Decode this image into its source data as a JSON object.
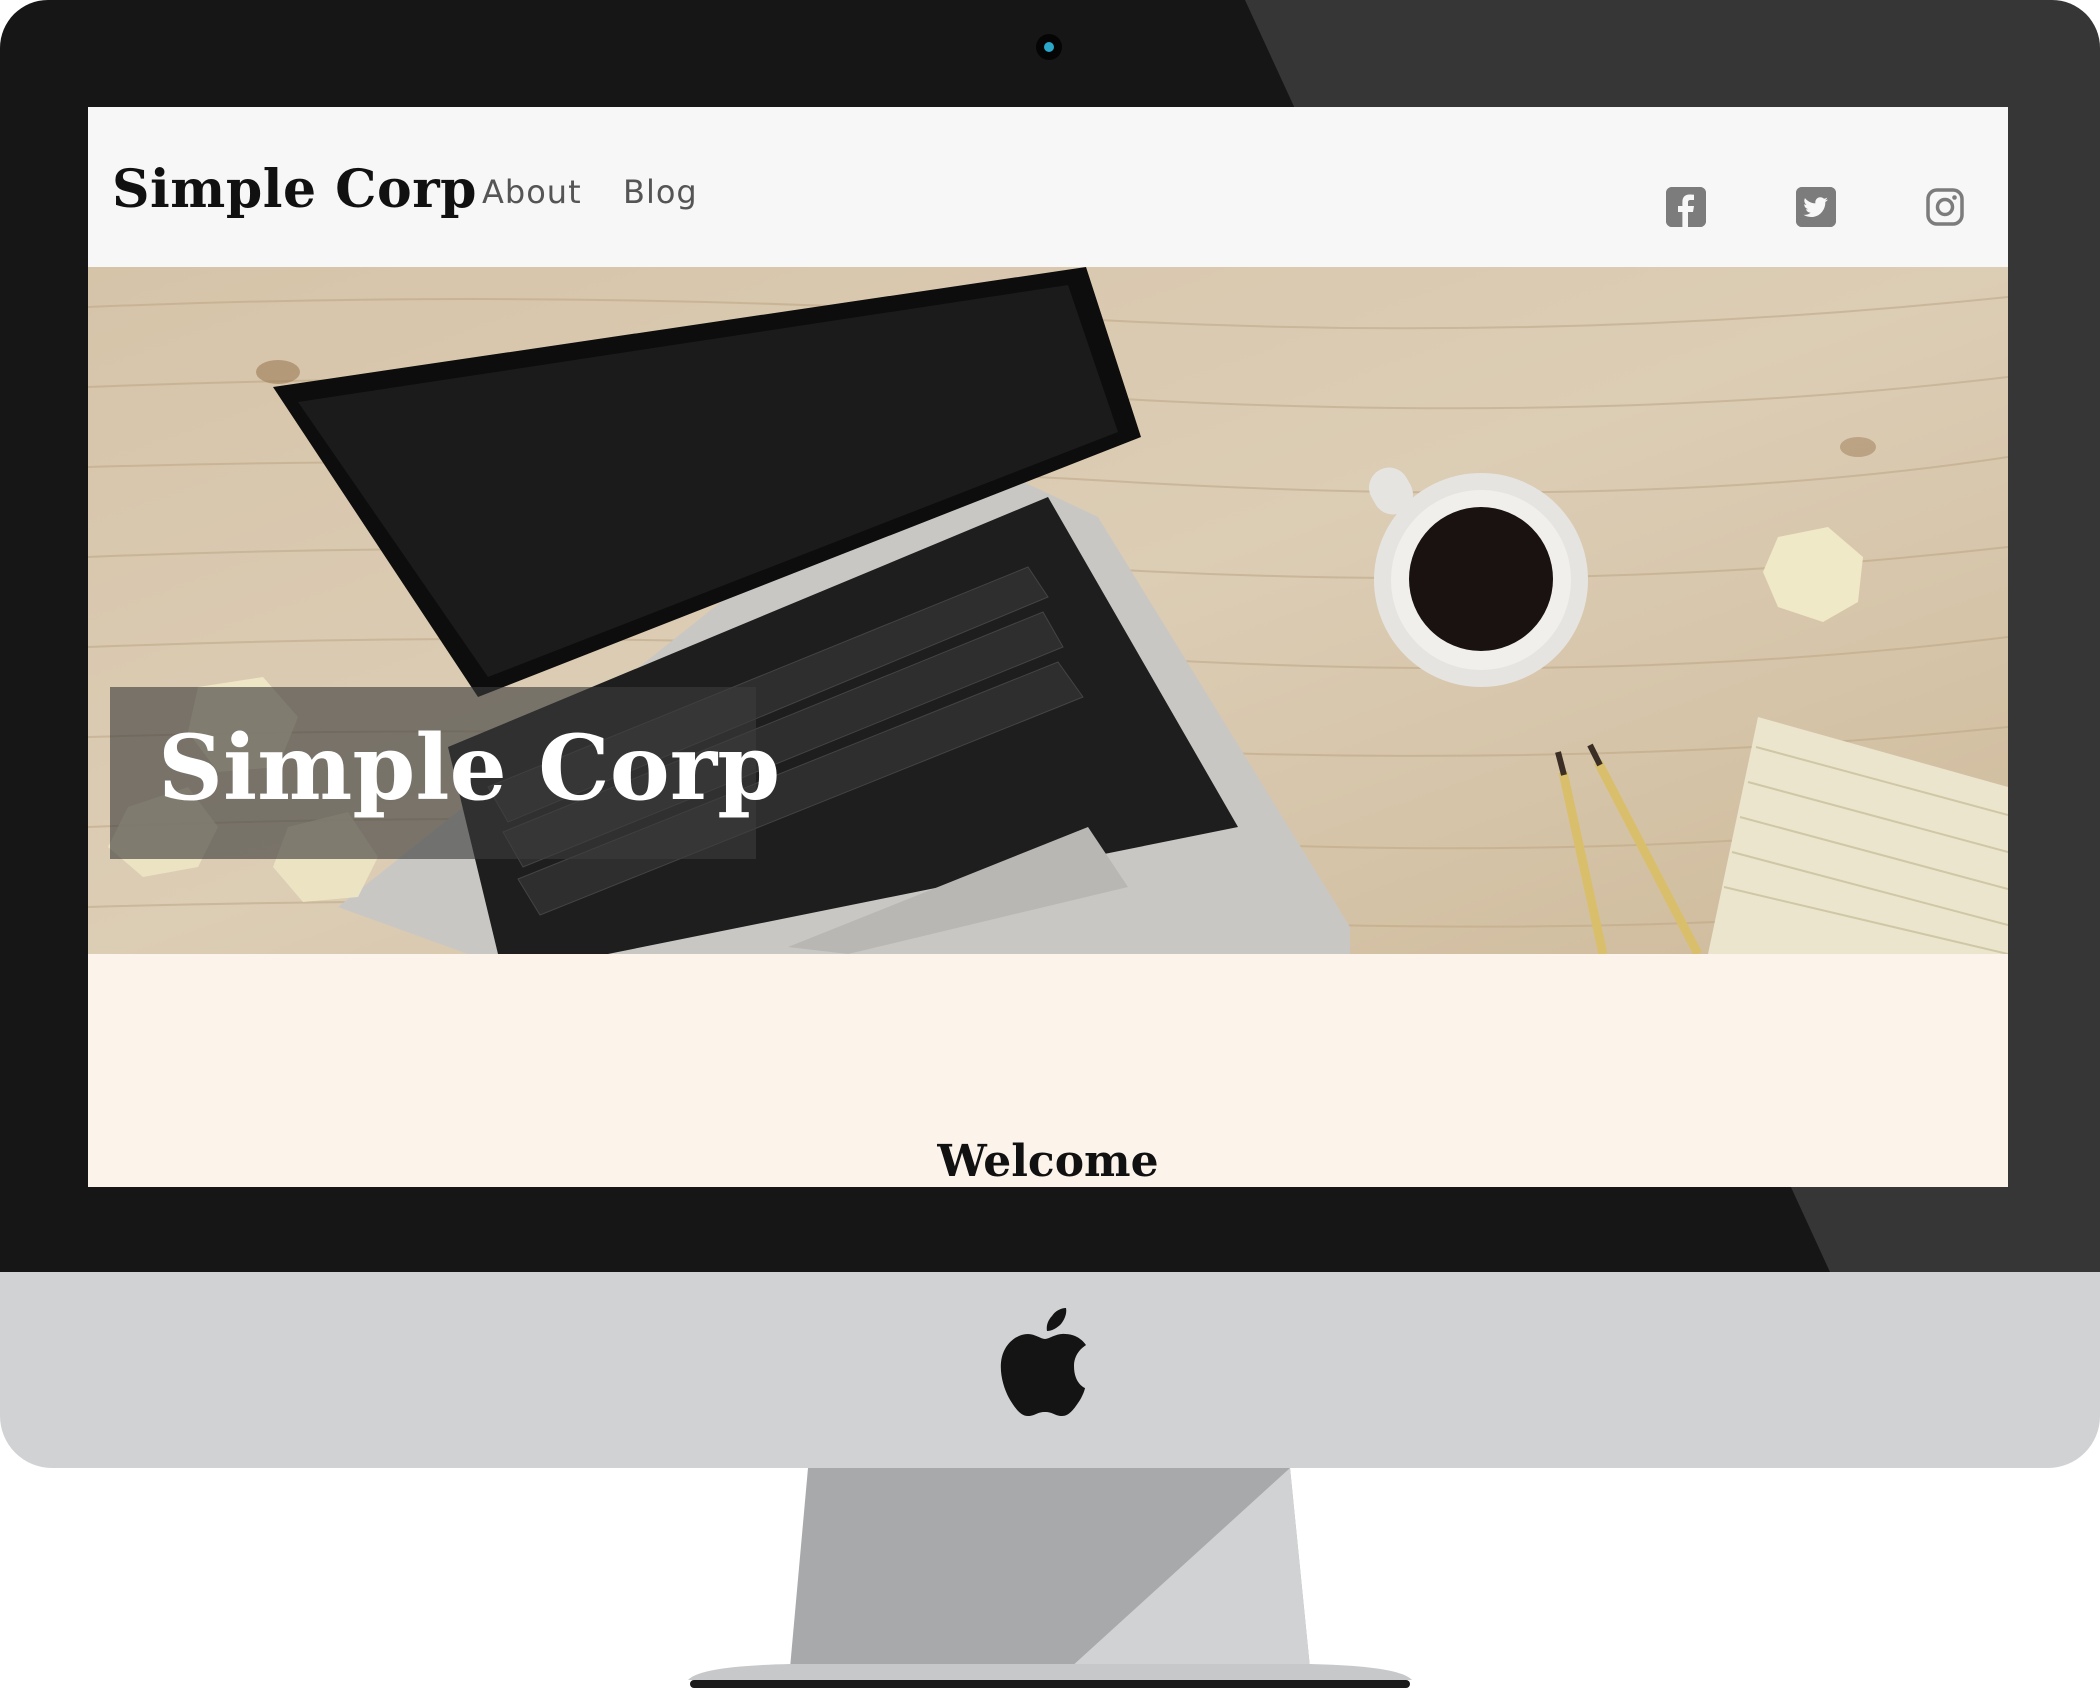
{
  "site": {
    "brand": "Simple Corp",
    "nav_links": [
      "About",
      "Blog"
    ],
    "social_icons": [
      "facebook-icon",
      "twitter-icon",
      "instagram-icon"
    ]
  },
  "hero": {
    "title": "Simple Corp"
  },
  "content": {
    "heading": "Welcome"
  },
  "colors": {
    "bezel": "#161616",
    "chin": "#d1d2d4",
    "nav_background": "#f7f7f7",
    "content_background": "#fcf3eb",
    "icon_gray": "#7c7c7c"
  }
}
